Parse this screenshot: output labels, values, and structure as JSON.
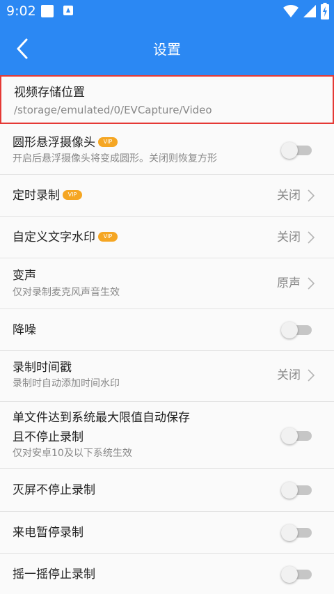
{
  "status_bar": {
    "time": "9:02",
    "icons": [
      "notification-square-icon",
      "app-a-icon",
      "wifi-icon",
      "cell-signal-icon",
      "battery-charging-icon"
    ]
  },
  "app_bar": {
    "title": "设置",
    "back_icon": "back-chevron-icon"
  },
  "colors": {
    "primary": "#2b88f3",
    "vip_badge": "#f5a623",
    "highlight_border": "#e53935"
  },
  "settings": [
    {
      "id": "video-path",
      "title": "视频存储位置",
      "subtitle": "/storage/emulated/0/EVCapture/Video"
    },
    {
      "id": "round-camera",
      "title": "圆形悬浮摄像头",
      "vip": "VIP",
      "subtitle": "开启后悬浮摄像头将变成圆形。关闭则恢复方形",
      "toggle": false
    },
    {
      "id": "timed-record",
      "title": "定时录制",
      "vip": "VIP",
      "value": "关闭"
    },
    {
      "id": "text-watermark",
      "title": "自定义文字水印",
      "vip": "VIP",
      "value": "关闭"
    },
    {
      "id": "voice-change",
      "title": "变声",
      "subtitle": "仅对录制麦克风声音生效",
      "value": "原声"
    },
    {
      "id": "noise-reduction",
      "title": "降噪",
      "toggle": false
    },
    {
      "id": "timestamp",
      "title": "录制时间戳",
      "subtitle": "录制时自动添加时间水印",
      "value": "关闭"
    },
    {
      "id": "auto-save",
      "title_line1": "单文件达到系统最大限值自动保存",
      "title_line2": "且不停止录制",
      "subtitle": "仅对安卓10及以下系统生效",
      "toggle": false
    },
    {
      "id": "screen-off",
      "title": "灭屏不停止录制",
      "toggle": false
    },
    {
      "id": "call-pause",
      "title": "来电暂停录制",
      "toggle": false
    },
    {
      "id": "shake-stop",
      "title": "摇一摇停止录制",
      "toggle": false
    }
  ]
}
